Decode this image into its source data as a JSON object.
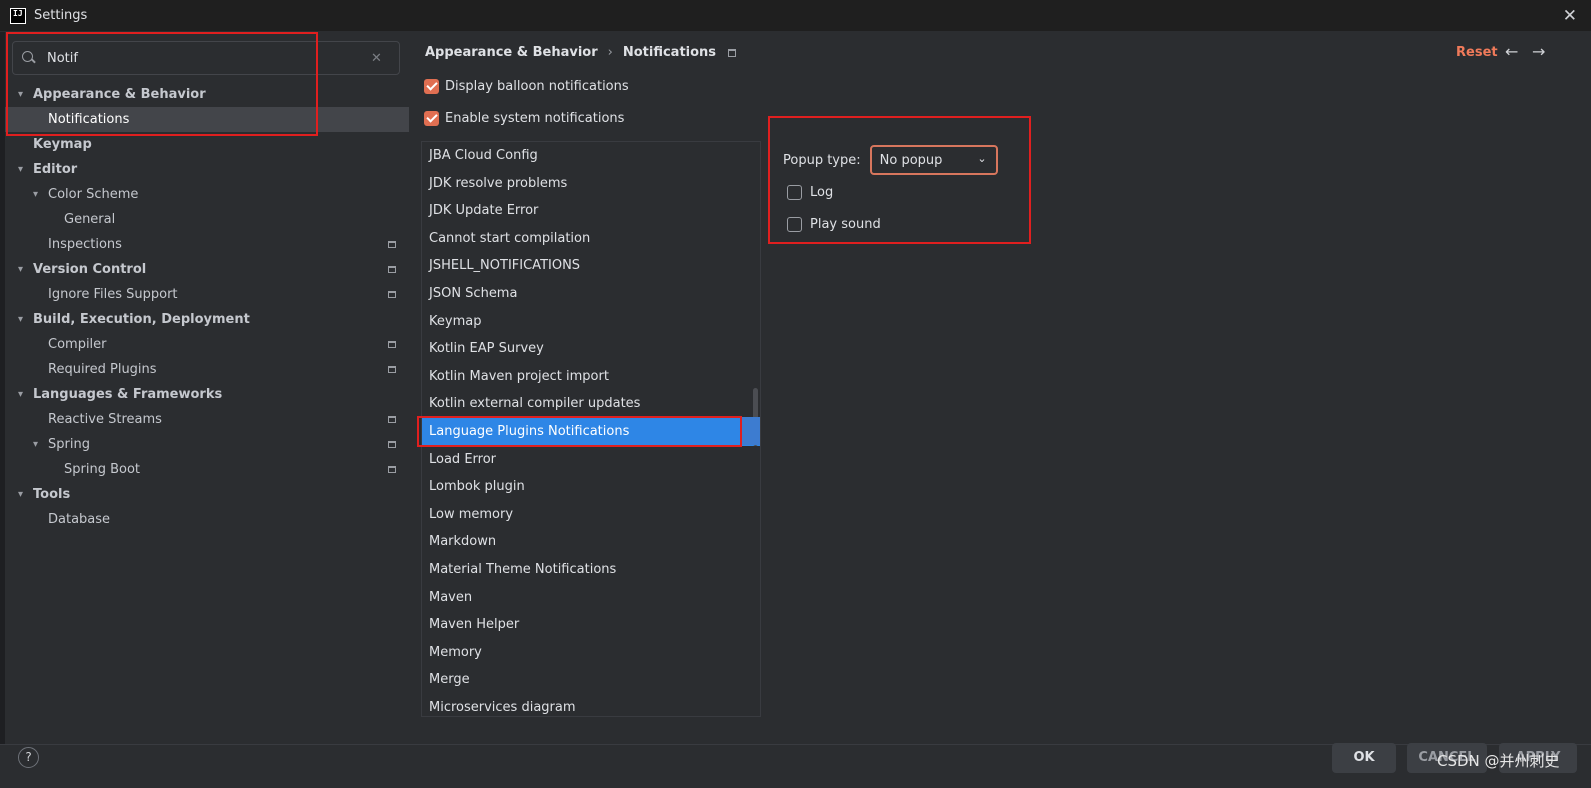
{
  "window": {
    "title": "Settings",
    "logo_text": "IJ"
  },
  "search": {
    "value": "Notif"
  },
  "tree": [
    {
      "label": "Appearance & Behavior",
      "bold": true,
      "level": 0,
      "expanded": true,
      "selected": false,
      "badge": false
    },
    {
      "label": "Notifications",
      "bold": false,
      "level": 1,
      "selected": true,
      "badge": false
    },
    {
      "label": "Keymap",
      "bold": true,
      "level": 0,
      "selected": false,
      "badge": false
    },
    {
      "label": "Editor",
      "bold": true,
      "level": 0,
      "expanded": true,
      "selected": false,
      "badge": false
    },
    {
      "label": "Color Scheme",
      "bold": false,
      "level": 1,
      "expanded": true,
      "selected": false,
      "badge": false
    },
    {
      "label": "General",
      "bold": false,
      "level": 2,
      "selected": false,
      "badge": false
    },
    {
      "label": "Inspections",
      "bold": false,
      "level": 1,
      "selected": false,
      "badge": true
    },
    {
      "label": "Version Control",
      "bold": true,
      "level": 0,
      "expanded": true,
      "selected": false,
      "badge": true
    },
    {
      "label": "Ignore Files Support",
      "bold": false,
      "level": 1,
      "selected": false,
      "badge": true
    },
    {
      "label": "Build, Execution, Deployment",
      "bold": true,
      "level": 0,
      "expanded": true,
      "selected": false,
      "badge": false
    },
    {
      "label": "Compiler",
      "bold": false,
      "level": 1,
      "selected": false,
      "badge": true
    },
    {
      "label": "Required Plugins",
      "bold": false,
      "level": 1,
      "selected": false,
      "badge": true
    },
    {
      "label": "Languages & Frameworks",
      "bold": true,
      "level": 0,
      "expanded": true,
      "selected": false,
      "badge": false
    },
    {
      "label": "Reactive Streams",
      "bold": false,
      "level": 1,
      "selected": false,
      "badge": true
    },
    {
      "label": "Spring",
      "bold": false,
      "level": 1,
      "expanded": true,
      "selected": false,
      "badge": true
    },
    {
      "label": "Spring Boot",
      "bold": false,
      "level": 2,
      "selected": false,
      "badge": true
    },
    {
      "label": "Tools",
      "bold": true,
      "level": 0,
      "expanded": true,
      "selected": false,
      "badge": false
    },
    {
      "label": "Database",
      "bold": false,
      "level": 1,
      "selected": false,
      "badge": false
    }
  ],
  "breadcrumb": {
    "parent": "Appearance & Behavior",
    "separator": "›",
    "current": "Notifications"
  },
  "header": {
    "reset_label": "Reset",
    "back_icon": "←",
    "forward_icon": "→"
  },
  "options": {
    "display_balloon": {
      "label": "Display balloon notifications",
      "checked": true
    },
    "enable_system": {
      "label": "Enable system notifications",
      "checked": true
    }
  },
  "groups": [
    "JBA Cloud Config",
    "JDK resolve problems",
    "JDK Update Error",
    "Cannot start compilation",
    "JSHELL_NOTIFICATIONS",
    "JSON Schema",
    "Keymap",
    "Kotlin EAP Survey",
    "Kotlin Maven project import",
    "Kotlin external compiler updates",
    "Language Plugins Notifications",
    "Load Error",
    "Lombok plugin",
    "Low memory",
    "Markdown",
    "Material Theme Notifications",
    "Maven",
    "Maven Helper",
    "Memory",
    "Merge",
    "Microservices diagram"
  ],
  "selected_group": "Language Plugins Notifications",
  "group_settings": {
    "popup_type_label": "Popup type:",
    "popup_type_value": "No popup",
    "log": {
      "label": "Log",
      "checked": false
    },
    "play_sound": {
      "label": "Play sound",
      "checked": false
    }
  },
  "footer": {
    "help_label": "?",
    "ok_label": "OK",
    "cancel_label": "CANCEL",
    "apply_label": "APPLY",
    "watermark": "CSDN @并州刺史"
  },
  "colors": {
    "accent": "#e06f52",
    "selection": "#2e86e6",
    "annotation_red": "#e01f1f",
    "link_reset": "#f07a5a"
  }
}
